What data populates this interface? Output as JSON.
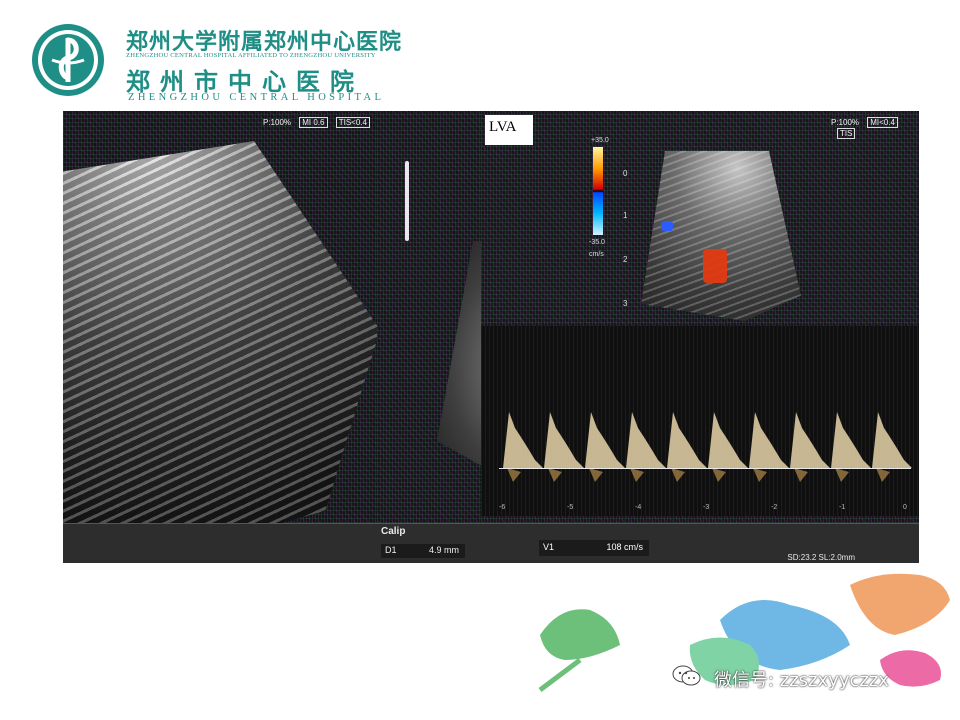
{
  "header": {
    "hospital_name_cn": "郑州大学附属郑州中心医院",
    "hospital_name_en_small": "ZHENGZHOU CENTRAL HOSPITAL AFFILIATED TO ZHENGZHOU UNIVERSITY",
    "hospital_city_cn": "郑州市中心医院",
    "hospital_name_en": "ZHENGZHOU CENTRAL HOSPITAL"
  },
  "ultrasound": {
    "left_panel": {
      "power": "P:100%",
      "mi": "MI 0.6",
      "tis": "TIS<0.4"
    },
    "right_panel": {
      "label": "LVA",
      "power": "P:100%",
      "mi": "MI<0.4",
      "tis": "TIS",
      "color_scale_top": "+35.0",
      "color_scale_bottom": "-35.0",
      "color_scale_unit": "cm/s",
      "depth_labels": [
        "0",
        "1",
        "2",
        "3"
      ],
      "time_labels": [
        "-6",
        "-5",
        "-4",
        "-3",
        "-2",
        "-1",
        "0"
      ],
      "sd_readout": "SD:23.2  SL:2.0mm"
    },
    "measurements": {
      "calip_label": "Calip",
      "d1_label": "D1",
      "d1_value": "4.9 mm",
      "v1_label": "V1",
      "v1_value": "108 cm/s"
    }
  },
  "watermark": {
    "text": "微信号: zzszxyyczzx"
  },
  "colors": {
    "brand_teal": "#1f8e86",
    "leaf_green": "#6cc07a",
    "leaf_blue": "#6fb8e6",
    "leaf_orange": "#f2a66f",
    "leaf_pink": "#ec6aa5"
  }
}
